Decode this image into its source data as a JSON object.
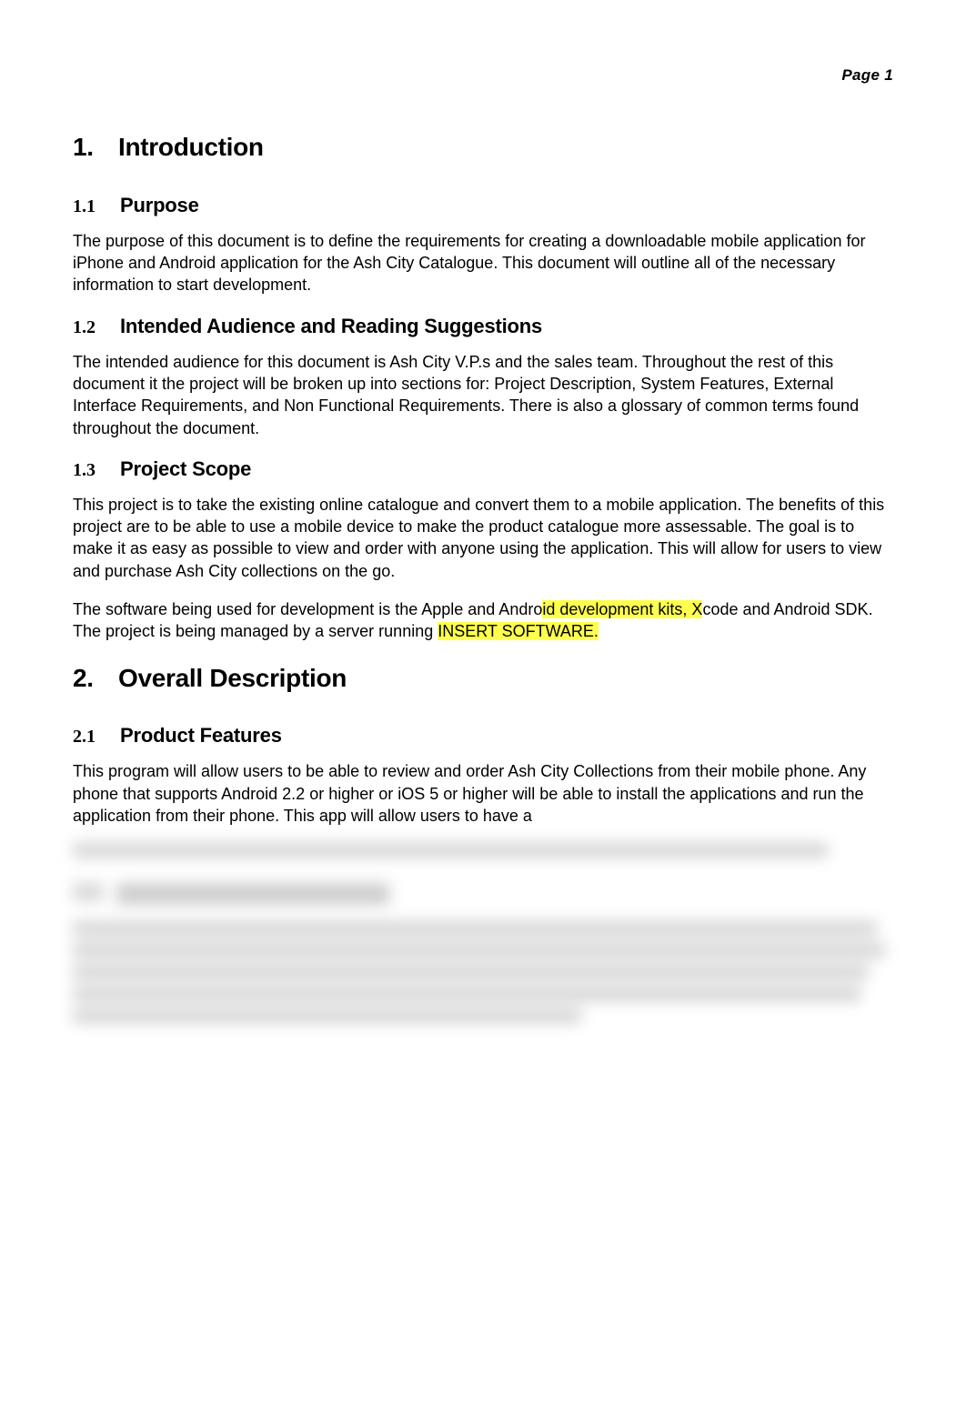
{
  "page_header": "Page 1",
  "sections": {
    "s1": {
      "num": "1.",
      "title": "Introduction",
      "sub1": {
        "num": "1.1",
        "title": "Purpose",
        "para": "The purpose of this document is to define the requirements for creating a downloadable mobile application for iPhone and Android application for the Ash City Catalogue.  This document will outline all of the necessary information to start development."
      },
      "sub2": {
        "num": "1.2",
        "title": "Intended Audience and Reading Suggestions",
        "para": "The intended audience for this document is Ash City V.P.s and the sales team. Throughout the rest of this document it the project will be broken up into sections for: Project Description, System Features, External Interface Requirements, and Non Functional Requirements.  There is also a glossary of common terms found throughout the document."
      },
      "sub3": {
        "num": "1.3",
        "title": "Project Scope",
        "para1": "This project is to take the existing online catalogue and convert them to a mobile application.  The benefits of this project are to be able to use a mobile device to make the product catalogue more assessable. The goal is to make it as easy as possible to view and order with anyone using the application. This will allow for users to view and purchase Ash City collections on the go.",
        "para2_a": "The software being used for development is the Apple and Andro",
        "para2_hl1": "id development kits, X",
        "para2_b": "code and Android SDK. The project is being managed by a server running ",
        "para2_hl2": "INSERT SOFTWARE."
      }
    },
    "s2": {
      "num": "2.",
      "title": "Overall Description",
      "sub1": {
        "num": "2.1",
        "title": "Product Features",
        "para": "This program will allow users to be able to review and order Ash City Collections from their mobile phone.  Any phone that supports Android 2.2 or higher or iOS 5 or higher will be able to install the applications and run the application from their phone.  This app will allow users to have a"
      }
    }
  }
}
